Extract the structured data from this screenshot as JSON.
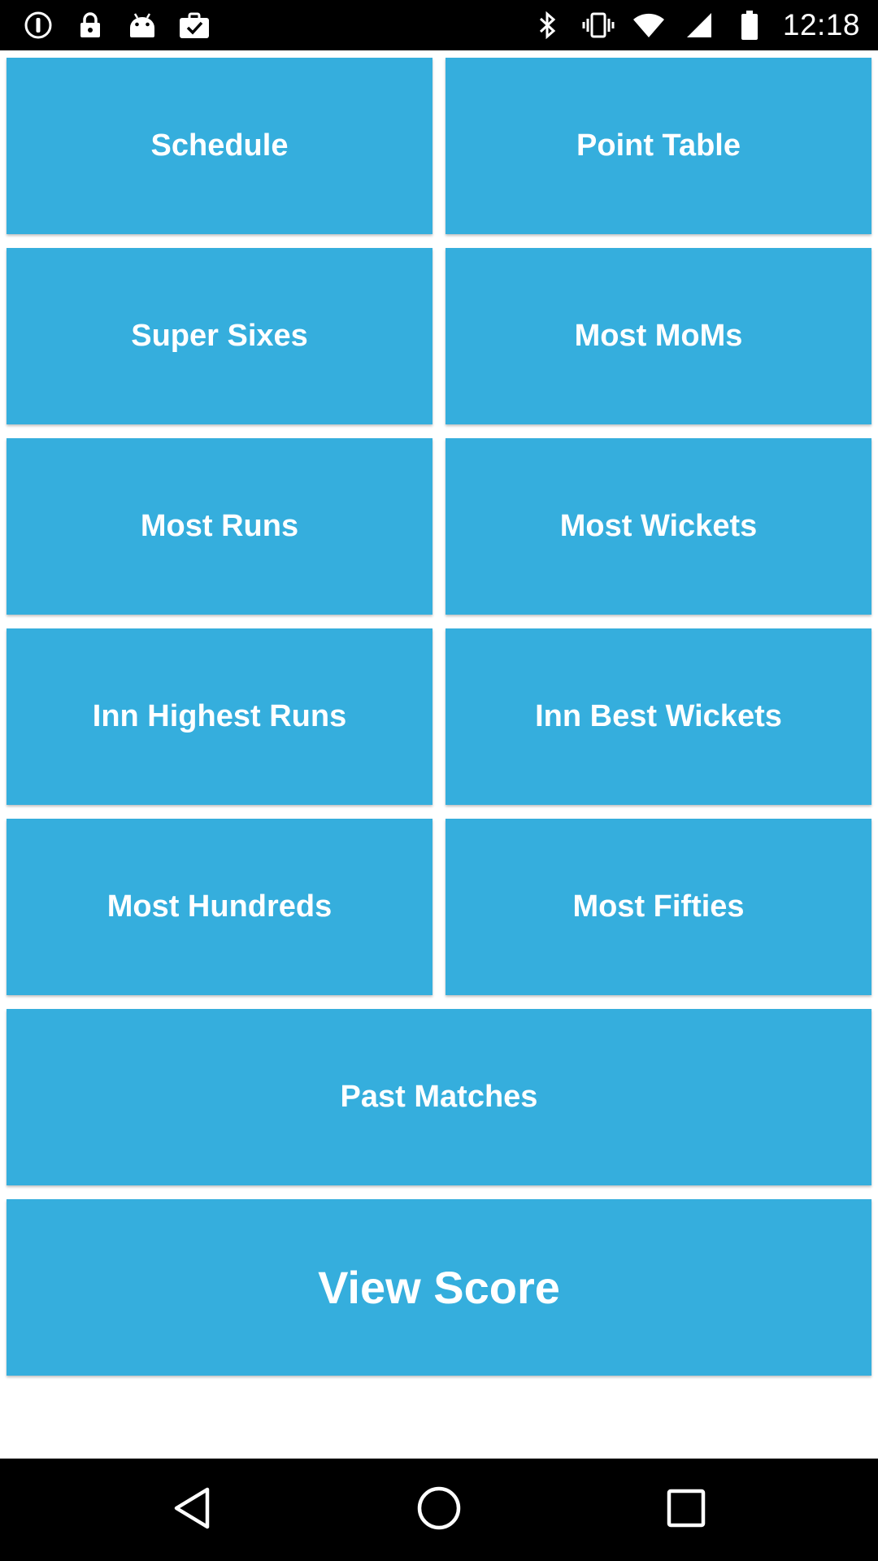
{
  "status_bar": {
    "time": "12:18",
    "left_icons": [
      "alert-circle-icon",
      "lock-icon",
      "android-icon",
      "briefcase-check-icon"
    ],
    "right_icons": [
      "bluetooth-icon",
      "vibrate-icon",
      "wifi-icon",
      "signal-icon",
      "battery-icon"
    ]
  },
  "menu": {
    "schedule": "Schedule",
    "point_table": "Point Table",
    "super_sixes": "Super Sixes",
    "most_moms": "Most MoMs",
    "most_runs": "Most Runs",
    "most_wickets": "Most Wickets",
    "inn_highest_runs": "Inn Highest Runs",
    "inn_best_wickets": "Inn Best Wickets",
    "most_hundreds": "Most Hundreds",
    "most_fifties": "Most Fifties",
    "past_matches": "Past Matches",
    "view_score": "View Score"
  },
  "nav_bar": {
    "icons": [
      "back-triangle-icon",
      "home-circle-icon",
      "recents-square-icon"
    ]
  },
  "colors": {
    "tile": "#35aedd",
    "status_bar": "#000000",
    "nav_bar": "#000000",
    "background": "#ffffff",
    "tile_text": "#ffffff"
  }
}
